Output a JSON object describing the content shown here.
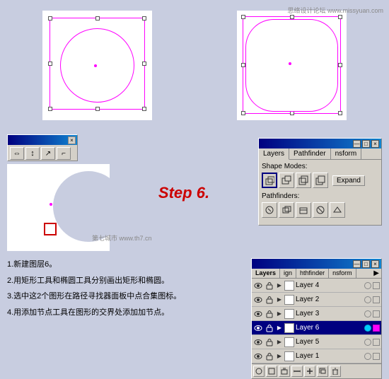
{
  "watermark_top": "思络设计论坛 www.missyuan.com",
  "watermark_bottom": "第七城市 www.th7.cn",
  "step_label": "Step 6.",
  "instructions": [
    "1.新建图层6。",
    "2.用矩形工具和椭圆工具分别画出矩形和椭圆。",
    "3.选中这2个图形在路径寻找器面板中点合集图标。",
    "4.用添加节点工具在图形的交界处添加加节点。"
  ],
  "pathfinder": {
    "title": "—  □  ×",
    "tabs": [
      "Layers",
      "Pathfinder",
      "nsform"
    ],
    "shape_modes_label": "Shape Modes:",
    "expand_label": "Expand",
    "pathfinders_label": "Pathfinders:"
  },
  "layers": {
    "title": "—  □  ×",
    "tabs": [
      "Layers",
      "ign",
      "hthfinder",
      "nsform"
    ],
    "rows": [
      {
        "name": "Layer 4",
        "visible": true,
        "locked": false,
        "selected": false
      },
      {
        "name": "Layer 2",
        "visible": true,
        "locked": false,
        "selected": false
      },
      {
        "name": "Layer 3",
        "visible": true,
        "locked": false,
        "selected": false
      },
      {
        "name": "Layer 6",
        "visible": true,
        "locked": false,
        "selected": true
      },
      {
        "name": "Layer 5",
        "visible": true,
        "locked": false,
        "selected": false
      },
      {
        "name": "Layer 1",
        "visible": true,
        "locked": false,
        "selected": false
      }
    ]
  },
  "tools": [
    "↔",
    "↕",
    "↗",
    "⌐"
  ]
}
